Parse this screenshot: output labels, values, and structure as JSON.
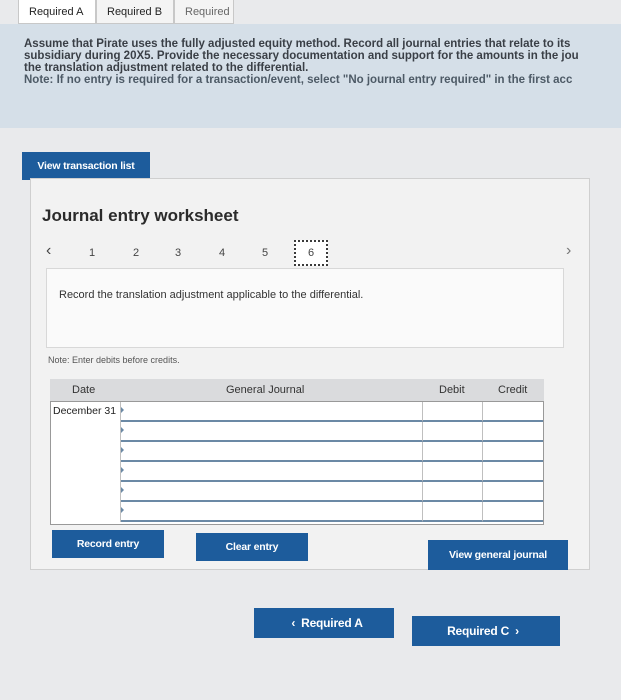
{
  "tabs": [
    {
      "label": "Required A"
    },
    {
      "label": "Required B"
    },
    {
      "label": "Required C"
    }
  ],
  "instructions": {
    "line1": "Assume that Pirate uses the fully adjusted equity method. Record all journal entries that relate to its",
    "line2": "subsidiary during 20X5. Provide the necessary documentation and support for the amounts in the jou",
    "line3": "the translation adjustment related to the differential.",
    "line4": "Note: If no entry is required for a transaction/event, select \"No journal entry required\" in the first acc"
  },
  "view_transaction_list": "View transaction list",
  "worksheet": {
    "title": "Journal entry worksheet",
    "pages": [
      "1",
      "2",
      "3",
      "4",
      "5",
      "6"
    ],
    "active_page": "6",
    "description": "Record the translation adjustment applicable to the differential.",
    "note": "Note: Enter debits before credits."
  },
  "journal": {
    "headers": {
      "date": "Date",
      "general_journal": "General Journal",
      "debit": "Debit",
      "credit": "Credit"
    },
    "rows": [
      {
        "date": "December 31"
      },
      {
        "date": ""
      },
      {
        "date": ""
      },
      {
        "date": ""
      },
      {
        "date": ""
      },
      {
        "date": ""
      }
    ]
  },
  "buttons": {
    "record_entry": "Record entry",
    "clear_entry": "Clear entry",
    "view_general_journal": "View general journal",
    "prev": "Required A",
    "next": "Required C"
  },
  "icons": {
    "prev_page": "chevron-left-icon",
    "next_page": "chevron-right-icon"
  }
}
